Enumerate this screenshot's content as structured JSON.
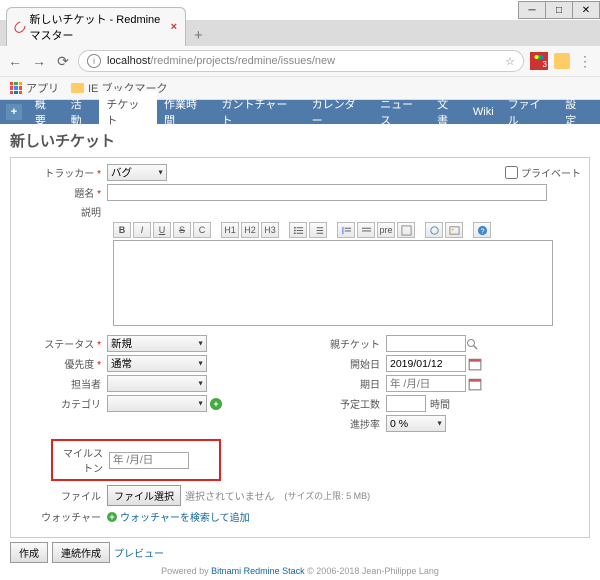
{
  "browser": {
    "tab_title": "新しいチケット - Redmineマスター",
    "url_host": "localhost",
    "url_path": "/redmine/projects/redmine/issues/new",
    "ext_badge": "3",
    "bookmarks": {
      "apps": "アプリ",
      "ie": "IE ブックマーク"
    }
  },
  "menu": {
    "overview": "概要",
    "activity": "活動",
    "issues": "チケット",
    "time": "作業時間",
    "gantt": "ガントチャート",
    "calendar": "カレンダー",
    "news": "ニュース",
    "documents": "文書",
    "wiki": "Wiki",
    "files": "ファイル",
    "settings": "設定"
  },
  "page": {
    "title": "新しいチケット"
  },
  "form": {
    "tracker_label": "トラッカー",
    "tracker_value": "バグ",
    "private_label": "プライベート",
    "subject_label": "題名",
    "description_label": "説明",
    "status_label": "ステータス",
    "status_value": "新規",
    "priority_label": "優先度",
    "priority_value": "通常",
    "assignee_label": "担当者",
    "category_label": "カテゴリ",
    "parent_label": "親チケット",
    "start_label": "開始日",
    "start_value": "2019/01/12",
    "due_label": "期日",
    "due_placeholder": "年 /月/日",
    "estimated_label": "予定工数",
    "estimated_unit": "時間",
    "done_label": "進捗率",
    "done_value": "0 %",
    "milestone_label": "マイルストン",
    "milestone_placeholder": "年 /月/日",
    "files_label": "ファイル",
    "files_button": "ファイル選択",
    "files_none": "選択されていません",
    "files_limit": "(サイズの上限: 5 MB)",
    "watchers_label": "ウォッチャー",
    "watchers_add": "ウォッチャーを検索して追加"
  },
  "toolbar": {
    "bold": "B",
    "italic": "I",
    "underline": "U",
    "strike": "S",
    "code": "C",
    "h1": "H1",
    "h2": "H2",
    "h3": "H3",
    "pre": "pre"
  },
  "actions": {
    "create": "作成",
    "create_continue": "連続作成",
    "preview": "プレビュー"
  },
  "footer": {
    "powered": "Powered by ",
    "link": "Bitnami Redmine Stack",
    "copyright": " © 2006-2018 Jean-Philippe Lang"
  }
}
